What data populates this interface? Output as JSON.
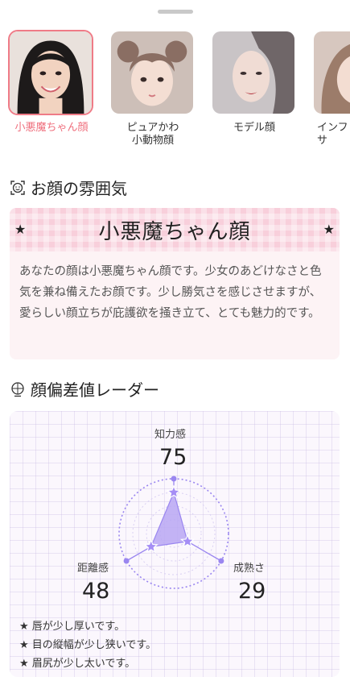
{
  "face_types": [
    {
      "label": "小悪魔ちゃん顔",
      "active": true
    },
    {
      "label": "ピュアかわ\n小動物顔",
      "active": false
    },
    {
      "label": "モデル顔",
      "active": false
    },
    {
      "label": "インフ\nサ",
      "active": false
    }
  ],
  "atmosphere": {
    "title": "お顔の雰囲気",
    "icon": "smiley-face-icon",
    "star": "★",
    "type_name": "小悪魔ちゃん顔",
    "description": "あなたの顔は小悪魔ちゃん顔です。少女のあどけなさと色気を兼ね備えたお顔です。少し勝気さを感じさせますが、愛らしい顔立ちが庇護欲を掻き立て、とても魅力的です。"
  },
  "radar": {
    "title": "顔偏差値レーダー",
    "icon": "face-outline-icon",
    "axes": [
      {
        "label": "知力感",
        "value": 75
      },
      {
        "label": "成熟さ",
        "value": 29
      },
      {
        "label": "距離感",
        "value": 48
      }
    ],
    "notes": [
      "★ 唇が少し厚いです。",
      "★ 目の縦幅が少し狭いです。",
      "★ 眉尻が少し太いです。"
    ],
    "colors": {
      "fill": "#b9a7f3",
      "stroke": "#9a86f0",
      "accent": "#ef6f7d"
    }
  }
}
